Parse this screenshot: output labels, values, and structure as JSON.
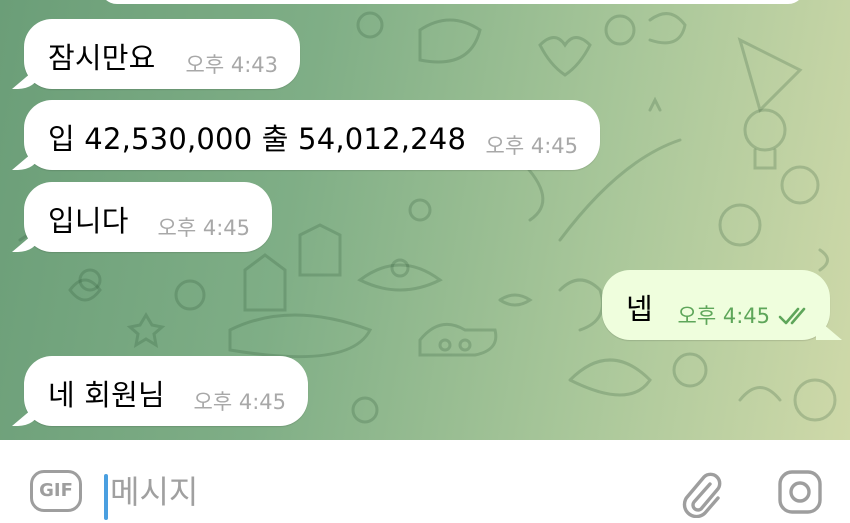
{
  "messages": [
    {
      "text": "잠시만요",
      "time": "오후 4:43",
      "direction": "incoming"
    },
    {
      "text": "입 42,530,000  출 54,012,248",
      "time": "오후 4:45",
      "direction": "incoming"
    },
    {
      "text": "입니다",
      "time": "오후 4:45",
      "direction": "incoming"
    },
    {
      "text": "넵",
      "time": "오후 4:45",
      "direction": "outgoing",
      "status": "read"
    },
    {
      "text": "네 회원님",
      "time": "오후 4:45",
      "direction": "incoming"
    }
  ],
  "composer": {
    "gif_label": "GIF",
    "placeholder": "메시지",
    "value": ""
  },
  "icons": {
    "gif": "gif-icon",
    "attach": "paperclip-icon",
    "camera": "camera-icon",
    "read_status": "double-check-icon"
  },
  "colors": {
    "incoming_bubble": "#ffffff",
    "outgoing_bubble": "#effedd",
    "outgoing_time": "#5ea65a",
    "cursor": "#4a9fe0"
  }
}
